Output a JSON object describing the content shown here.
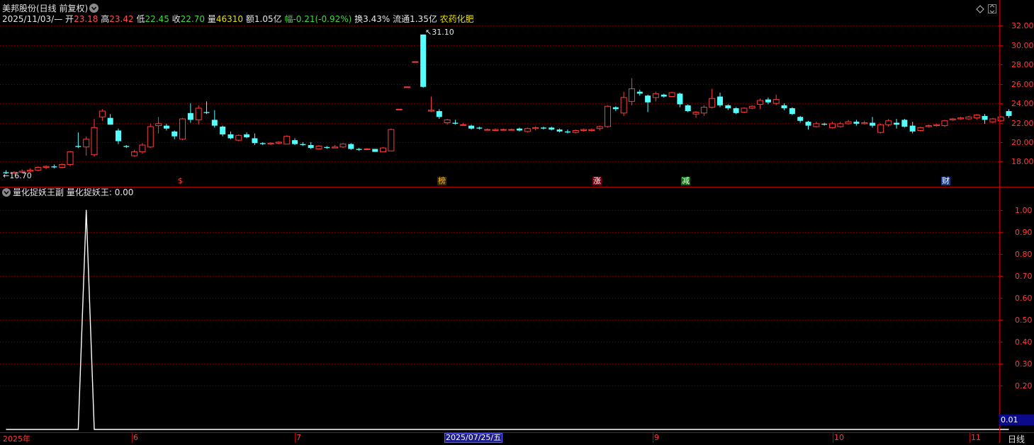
{
  "header": {
    "title": "美邦股份(日线 前复权)",
    "date": "2025/11/03/—",
    "open_label": "开",
    "open": "23.18",
    "high_label": "高",
    "high": "23.42",
    "low_label": "低",
    "low": "22.45",
    "close_label": "收",
    "close": "22.70",
    "vol_label": "量",
    "vol": "46310",
    "amount": "额1.05亿",
    "change": "幅-0.21(-0.92%)",
    "turnover": "换3.43%",
    "float": "流通1.35亿",
    "sector": "农药化肥"
  },
  "markers": {
    "high": "31.10",
    "low": "16.70"
  },
  "event_tags": [
    "$",
    "榜",
    "涨",
    "减",
    "财"
  ],
  "indicator": {
    "name": "量化捉妖王副",
    "value_label": "量化捉妖王: 0.00",
    "current": "0.01"
  },
  "x_axis": {
    "labels": [
      "2025年",
      "6",
      "7",
      "2025/07/25/五",
      "9",
      "10",
      "11"
    ],
    "period": "日线"
  },
  "colors": {
    "up": "#ff3b3b",
    "down": "#54ffff",
    "grid": "#7a0000",
    "axis": "#b00000"
  },
  "chart_data": [
    {
      "type": "candlestick",
      "y_ticks": [
        32.0,
        30.0,
        28.0,
        26.0,
        24.0,
        22.0,
        20.0,
        18.0
      ],
      "ylim": [
        16.2,
        33.2
      ],
      "annotations": [
        "31.10",
        "16.70"
      ],
      "ohlc": [
        [
          16.9,
          17.1,
          16.7,
          16.8
        ],
        [
          16.8,
          17.0,
          16.7,
          16.9
        ],
        [
          16.9,
          17.2,
          16.8,
          17.0
        ],
        [
          17.0,
          17.3,
          16.9,
          17.1
        ],
        [
          17.1,
          17.5,
          17.0,
          17.4
        ],
        [
          17.4,
          17.6,
          17.2,
          17.5
        ],
        [
          17.5,
          17.7,
          17.3,
          17.4
        ],
        [
          17.4,
          17.8,
          17.3,
          17.7
        ],
        [
          17.7,
          19.1,
          17.5,
          19.0
        ],
        [
          19.6,
          21.0,
          19.4,
          19.5
        ],
        [
          19.5,
          20.6,
          18.6,
          20.3
        ],
        [
          18.7,
          22.4,
          18.5,
          21.5
        ],
        [
          22.6,
          23.4,
          22.2,
          23.2
        ],
        [
          22.5,
          22.9,
          21.8,
          21.8
        ],
        [
          21.2,
          21.4,
          19.8,
          20.1
        ],
        [
          19.6,
          19.7,
          19.4,
          19.5
        ],
        [
          18.6,
          19.2,
          18.5,
          19.0
        ],
        [
          19.0,
          19.9,
          18.8,
          19.7
        ],
        [
          19.5,
          21.9,
          19.4,
          21.6
        ],
        [
          21.7,
          22.6,
          20.9,
          21.9
        ],
        [
          21.7,
          21.9,
          21.2,
          21.4
        ],
        [
          21.1,
          21.2,
          20.3,
          20.6
        ],
        [
          20.3,
          22.5,
          20.2,
          22.4
        ],
        [
          23.0,
          24.0,
          22.0,
          22.3
        ],
        [
          22.3,
          23.8,
          21.8,
          23.5
        ],
        [
          23.1,
          24.2,
          22.9,
          23.0
        ],
        [
          22.3,
          23.3,
          21.5,
          21.7
        ],
        [
          21.6,
          21.7,
          20.6,
          20.8
        ],
        [
          20.8,
          21.1,
          20.3,
          20.4
        ],
        [
          20.2,
          20.8,
          20.1,
          20.7
        ],
        [
          20.8,
          21.0,
          20.4,
          20.5
        ],
        [
          20.4,
          20.9,
          19.7,
          19.9
        ],
        [
          19.9,
          20.0,
          19.7,
          19.8
        ],
        [
          19.8,
          20.0,
          19.7,
          19.9
        ],
        [
          19.9,
          20.1,
          19.8,
          20.0
        ],
        [
          19.8,
          20.7,
          19.8,
          20.6
        ],
        [
          20.2,
          20.4,
          19.7,
          19.8
        ],
        [
          19.8,
          20.0,
          19.6,
          19.7
        ],
        [
          19.7,
          20.0,
          19.3,
          19.4
        ],
        [
          19.3,
          19.7,
          19.3,
          19.6
        ],
        [
          19.5,
          19.6,
          19.3,
          19.4
        ],
        [
          19.4,
          19.7,
          19.4,
          19.5
        ],
        [
          19.5,
          19.9,
          19.4,
          19.8
        ],
        [
          19.8,
          19.9,
          19.2,
          19.3
        ],
        [
          19.3,
          19.4,
          19.1,
          19.2
        ],
        [
          19.3,
          19.4,
          19.2,
          19.3
        ],
        [
          19.3,
          19.3,
          19.0,
          19.0
        ],
        [
          19.0,
          19.5,
          19.0,
          19.4
        ],
        [
          19.1,
          21.4,
          19.1,
          21.3
        ],
        [
          23.4,
          23.4,
          23.4,
          23.4
        ],
        [
          25.7,
          25.7,
          25.7,
          25.7
        ],
        [
          28.3,
          28.3,
          28.3,
          28.3
        ],
        [
          31.1,
          31.1,
          25.6,
          25.7
        ],
        [
          23.2,
          24.7,
          23.1,
          23.3
        ],
        [
          23.2,
          23.4,
          22.4,
          22.6
        ],
        [
          22.0,
          22.4,
          21.8,
          22.3
        ],
        [
          22.0,
          22.3,
          21.8,
          21.9
        ],
        [
          21.8,
          22.0,
          21.7,
          21.8
        ],
        [
          21.7,
          21.8,
          21.3,
          21.4
        ],
        [
          21.5,
          21.6,
          21.3,
          21.4
        ],
        [
          21.3,
          21.4,
          21.2,
          21.3
        ],
        [
          21.2,
          21.4,
          21.2,
          21.3
        ],
        [
          21.3,
          21.4,
          21.2,
          21.3
        ],
        [
          21.3,
          21.4,
          21.2,
          21.3
        ],
        [
          21.4,
          21.5,
          21.1,
          21.2
        ],
        [
          21.1,
          21.5,
          21.0,
          21.4
        ],
        [
          21.4,
          21.6,
          21.2,
          21.5
        ],
        [
          21.5,
          21.6,
          21.3,
          21.4
        ],
        [
          21.5,
          21.6,
          21.2,
          21.3
        ],
        [
          21.3,
          21.4,
          21.0,
          21.1
        ],
        [
          21.1,
          21.3,
          20.9,
          21.0
        ],
        [
          21.0,
          21.3,
          20.9,
          21.2
        ],
        [
          21.2,
          21.4,
          21.1,
          21.3
        ],
        [
          21.2,
          21.4,
          21.1,
          21.3
        ],
        [
          21.4,
          21.7,
          21.2,
          21.6
        ],
        [
          21.6,
          23.8,
          21.5,
          23.7
        ],
        [
          23.6,
          23.7,
          23.2,
          23.4
        ],
        [
          23.0,
          25.2,
          22.7,
          24.6
        ],
        [
          24.2,
          26.6,
          23.8,
          25.5
        ],
        [
          25.2,
          25.4,
          24.8,
          25.0
        ],
        [
          24.8,
          24.9,
          23.1,
          24.1
        ],
        [
          24.6,
          25.2,
          24.2,
          25.0
        ],
        [
          24.9,
          25.0,
          24.6,
          24.7
        ],
        [
          24.7,
          25.2,
          24.6,
          25.1
        ],
        [
          25.0,
          25.1,
          23.6,
          23.9
        ],
        [
          23.8,
          23.9,
          23.1,
          23.2
        ],
        [
          22.9,
          23.2,
          22.5,
          23.1
        ],
        [
          23.0,
          23.8,
          22.7,
          23.6
        ],
        [
          23.6,
          25.5,
          23.5,
          24.5
        ],
        [
          24.7,
          25.1,
          23.6,
          23.8
        ],
        [
          23.8,
          23.9,
          23.3,
          23.5
        ],
        [
          23.5,
          23.6,
          22.9,
          23.0
        ],
        [
          23.1,
          23.6,
          23.0,
          23.5
        ],
        [
          23.5,
          23.8,
          23.4,
          23.7
        ],
        [
          23.9,
          24.5,
          23.4,
          24.3
        ],
        [
          24.4,
          24.6,
          23.9,
          24.1
        ],
        [
          24.0,
          24.9,
          23.8,
          24.4
        ],
        [
          23.8,
          24.0,
          23.3,
          23.5
        ],
        [
          23.5,
          23.6,
          22.8,
          22.9
        ],
        [
          22.6,
          22.7,
          22.0,
          22.2
        ],
        [
          22.1,
          22.2,
          21.3,
          21.7
        ],
        [
          21.6,
          22.1,
          21.5,
          21.9
        ],
        [
          21.9,
          22.0,
          21.7,
          21.8
        ],
        [
          21.5,
          22.1,
          21.4,
          21.9
        ],
        [
          21.6,
          22.1,
          21.5,
          21.9
        ],
        [
          21.9,
          22.3,
          21.8,
          22.1
        ],
        [
          22.1,
          22.3,
          21.7,
          21.9
        ],
        [
          21.9,
          22.2,
          21.8,
          22.0
        ],
        [
          22.0,
          22.6,
          21.5,
          21.7
        ],
        [
          21.0,
          21.9,
          20.9,
          21.8
        ],
        [
          21.8,
          22.4,
          21.6,
          22.2
        ],
        [
          22.0,
          22.4,
          21.4,
          21.8
        ],
        [
          22.3,
          22.4,
          21.5,
          21.6
        ],
        [
          21.7,
          22.1,
          20.9,
          21.1
        ],
        [
          21.2,
          21.6,
          21.1,
          21.5
        ],
        [
          21.6,
          21.8,
          21.5,
          21.7
        ],
        [
          21.7,
          21.9,
          21.6,
          21.8
        ],
        [
          21.7,
          22.3,
          21.6,
          22.2
        ],
        [
          22.3,
          22.5,
          22.2,
          22.4
        ],
        [
          22.4,
          22.6,
          22.3,
          22.5
        ],
        [
          22.4,
          22.7,
          22.3,
          22.6
        ],
        [
          22.5,
          22.9,
          22.3,
          22.8
        ],
        [
          22.7,
          22.9,
          21.9,
          22.3
        ],
        [
          22.1,
          22.5,
          22.0,
          22.4
        ],
        [
          22.2,
          22.7,
          22.1,
          22.6
        ],
        [
          23.2,
          23.4,
          22.5,
          22.7
        ]
      ]
    },
    {
      "type": "line",
      "name": "量化捉妖王",
      "ylim": [
        0,
        1.07
      ],
      "y_ticks": [
        1.0,
        0.9,
        0.8,
        0.7,
        0.6,
        0.5,
        0.4,
        0.3,
        0.2
      ],
      "spike": {
        "bar_index": 10,
        "value": 1.0
      }
    }
  ]
}
